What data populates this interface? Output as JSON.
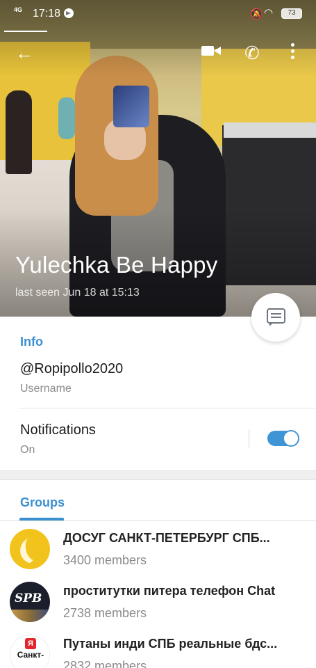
{
  "status_bar": {
    "network": "4G",
    "time": "17:18",
    "battery": "73"
  },
  "profile": {
    "name": "Yulechka Be Happy",
    "last_seen": "last seen Jun 18 at 15:13"
  },
  "info": {
    "section_title": "Info",
    "username_value": "@Ropipollo2020",
    "username_label": "Username",
    "notifications_label": "Notifications",
    "notifications_state": "On",
    "notifications_enabled": true
  },
  "groups": {
    "section_title": "Groups",
    "items": [
      {
        "name": "ДОСУГ САНКТ-ПЕТЕРБУРГ СПБ...",
        "members": "3400 members",
        "avatar_icon": "banana-moon-icon"
      },
      {
        "name": "проститутки питера телефон Chat",
        "members": "2738 members",
        "avatar_icon": "spb-logo-icon",
        "avatar_text": "SPB"
      },
      {
        "name": "Путаны инди СПБ реальные бдс...",
        "members": "2832 members",
        "avatar_icon": "heart-city-icon",
        "avatar_text": "Санкт-"
      }
    ]
  },
  "colors": {
    "accent": "#3a8fd0",
    "toggle_on": "#3f94d6"
  }
}
